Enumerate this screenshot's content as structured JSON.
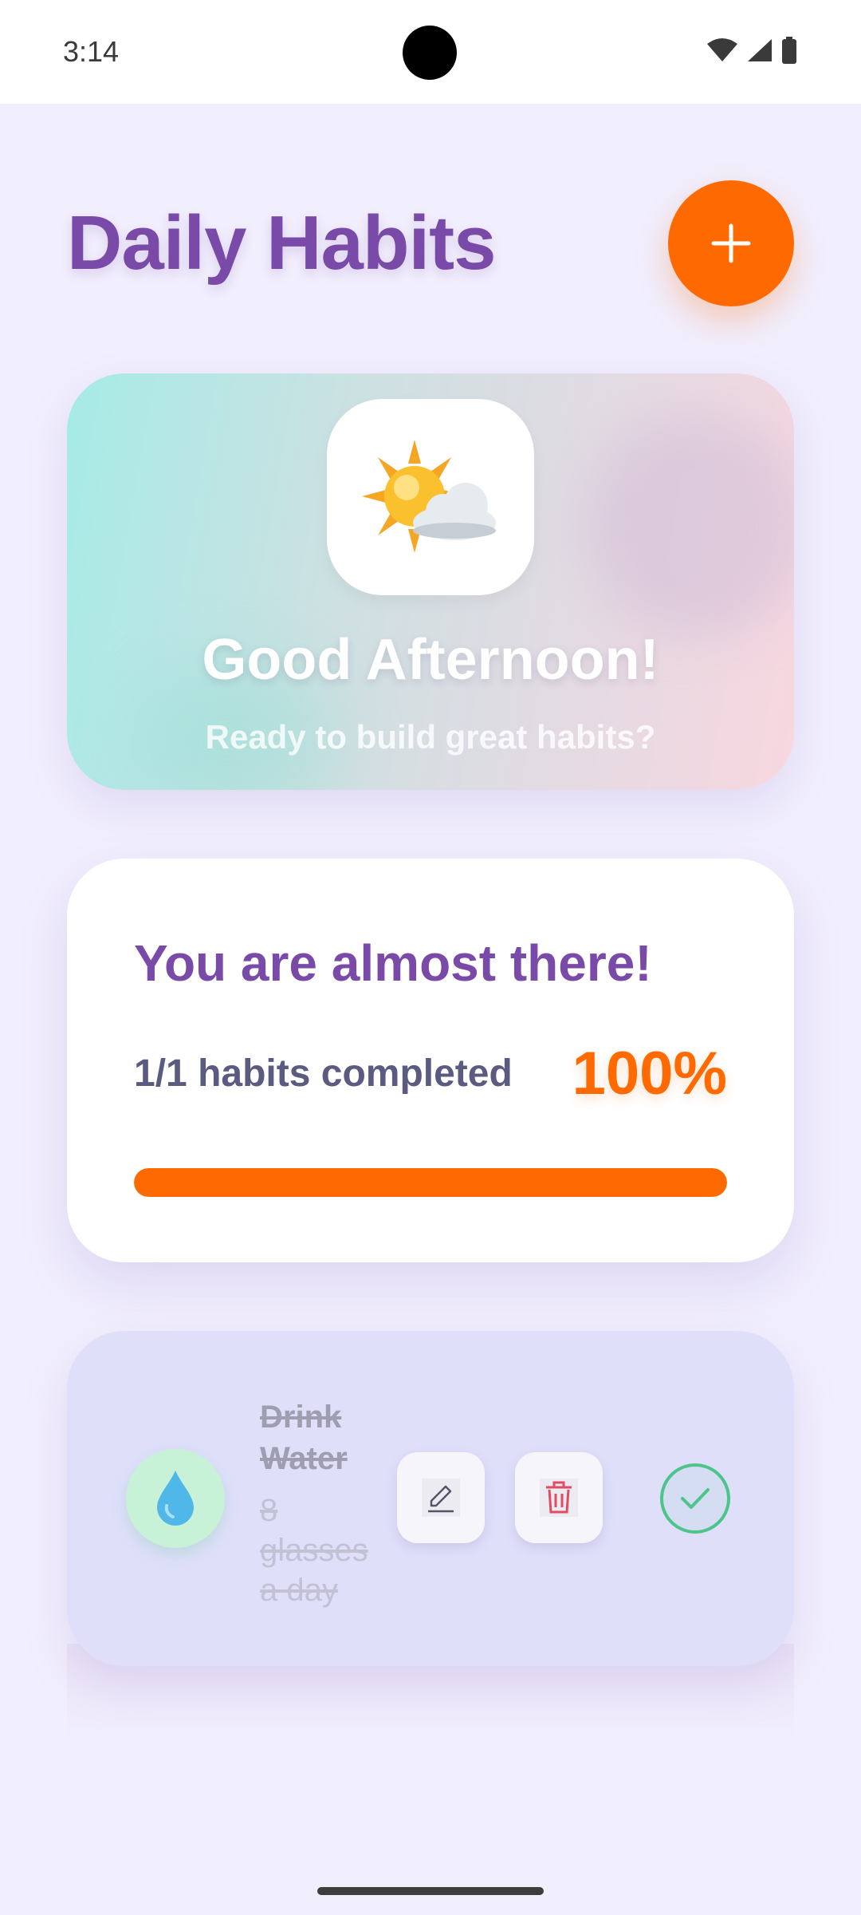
{
  "status_bar": {
    "time": "3:14"
  },
  "header": {
    "title": "Daily Habits",
    "add_button_label": "+"
  },
  "greeting_card": {
    "title": "Good Afternoon!",
    "subtitle": "Ready to build great habits?",
    "weather_icon": "sun-behind-cloud-icon"
  },
  "progress_card": {
    "title": "You are almost there!",
    "completed_text": "1/1 habits completed",
    "percent_text": "100%",
    "progress_fraction": 1.0
  },
  "habits": [
    {
      "name": "Drink Water",
      "description": "8 glasses a day",
      "icon": "water-drop-icon",
      "completed": true
    }
  ],
  "colors": {
    "accent": "#ff6a00",
    "title_purple": "#7a4aa8",
    "background": "#f1eefd",
    "habit_card": "#dfdffa",
    "success": "#4cc48a",
    "delete_red": "#e14b63"
  }
}
